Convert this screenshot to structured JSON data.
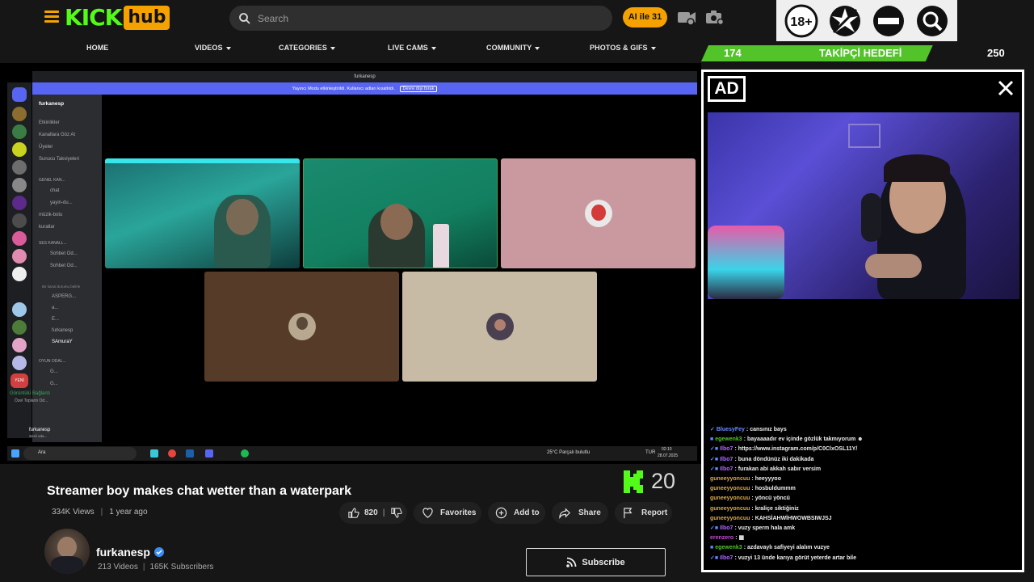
{
  "header": {
    "logo_kick": "KICK",
    "logo_hub": "hub",
    "search_placeholder": "Search",
    "pill_label": "AI ile 31",
    "badges": [
      "18-plus-badge",
      "no-flash-badge",
      "no-entry-badge",
      "search-badge"
    ],
    "badge_18": "18+"
  },
  "nav": {
    "items": [
      {
        "label": "HOME",
        "dropdown": false
      },
      {
        "label": "VIDEOS",
        "dropdown": true
      },
      {
        "label": "CATEGORIES",
        "dropdown": true
      },
      {
        "label": "LIVE CAMS",
        "dropdown": true
      },
      {
        "label": "COMMUNITY",
        "dropdown": true
      },
      {
        "label": "PHOTOS & GIFS",
        "dropdown": true
      }
    ]
  },
  "follow_goal": {
    "current": "174",
    "label": "TAKİPÇİ HEDEFİ",
    "target": "250",
    "progress": 0.696
  },
  "screen": {
    "window_title": "furkanesp",
    "banner_text": "Yayıncı Modu etkinleştirildi. Kullanıcı adları kısaltıldı.",
    "banner_button": "Devre dışı bırak",
    "server_name": "furkanesp",
    "channels": [
      "Etkinlikler",
      "Kanallara Göz At",
      "Üyeler",
      "Sunucu Takviyeleri",
      "GENEL KAN...",
      "chat",
      "yayin-du...",
      "müzik-botu",
      "kurallar",
      "SES KANALL...",
      "Sohbet Od...",
      "Sohbet Od...",
      "Bir kanal durumu belirle",
      "ASPERG...",
      "a...",
      "E...",
      "furkanesp",
      "SAmuraY",
      "OYUN ODAL...",
      "G...",
      "G...",
      "Görüntülü Bağlantı",
      "Özel Toplantı Od...",
      "furkanesp",
      "Sesli oda..."
    ],
    "taskbar_search": "Ara",
    "weather": "25°C  Parçalı bulutlu",
    "lang": "TUR",
    "time": "02:10",
    "date": "28.07.2025",
    "new_badge": "YENİ"
  },
  "kick_watermark": "20",
  "ad": {
    "tag": "AD"
  },
  "chat": {
    "messages": [
      {
        "user": "BluesyFey",
        "color": "#6b8cff",
        "icons": "✓",
        "text": "cansınız bays"
      },
      {
        "user": "egewenk3",
        "color": "#53c32a",
        "icons": "■",
        "text": "bayaaaadır ev içinde gözlük takmıyorum ☻"
      },
      {
        "user": "Ilbo7",
        "color": "#b06bff",
        "icons": "✓■",
        "text": "https://www.instagram.com/p/C0ClxOSL11Y/"
      },
      {
        "user": "Ilbo7",
        "color": "#b06bff",
        "icons": "✓■",
        "text": "buna döndünüz iki dakikada"
      },
      {
        "user": "Ilbo7",
        "color": "#b06bff",
        "icons": "✓■",
        "text": "furakan abi akkah sabır versim"
      },
      {
        "user": "guneeyyoncuu",
        "color": "#d7a94c",
        "icons": "",
        "text": "heeyyyoo"
      },
      {
        "user": "guneeyyoncuu",
        "color": "#d7a94c",
        "icons": "",
        "text": "hosbuldummm"
      },
      {
        "user": "guneeyyoncuu",
        "color": "#d7a94c",
        "icons": "",
        "text": "yöncü yöncü"
      },
      {
        "user": "guneeyyoncuu",
        "color": "#d7a94c",
        "icons": "",
        "text": "kraliçe siktiğiniz"
      },
      {
        "user": "guneeyyoncuu",
        "color": "#d7a94c",
        "icons": "",
        "text": "KAHSİAHWİHWOWBSIWJSJ"
      },
      {
        "user": "Ilbo7",
        "color": "#b06bff",
        "icons": "✓■",
        "text": "vuzy sperm hala amk"
      },
      {
        "user": "erenzero",
        "color": "#c94bd6",
        "icons": "",
        "text": "▦"
      },
      {
        "user": "egewenk3",
        "color": "#53c32a",
        "icons": "■",
        "text": "azdavaylı safiyeyi alalım vuzye"
      },
      {
        "user": "Ilbo7",
        "color": "#b06bff",
        "icons": "✓■",
        "text": "vuzyi 13 ünde karıya görüt yeterde artar bile"
      }
    ]
  },
  "video": {
    "title": "Streamer boy makes chat wetter than a waterpark",
    "views": "334K Views",
    "age": "1 year ago",
    "likes": "820",
    "favorites_label": "Favorites",
    "add_to_label": "Add to",
    "share_label": "Share",
    "report_label": "Report"
  },
  "channel": {
    "name": "furkanesp",
    "videos": "213 Videos",
    "subscribers": "165K Subscribers",
    "subscribe_label": "Subscribe"
  },
  "colors": {
    "kick_green": "#53fc18",
    "hub_orange": "#f5a200",
    "goal_green": "#53c32a",
    "discord_purple": "#5865f2"
  }
}
